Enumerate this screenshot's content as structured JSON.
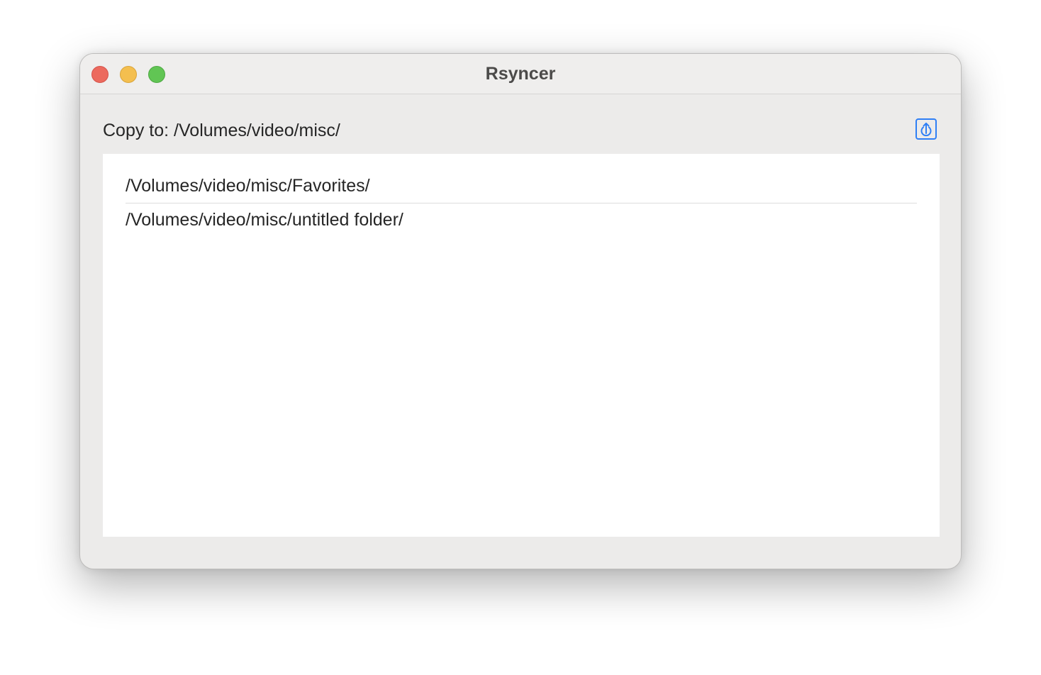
{
  "window": {
    "title": "Rsyncer"
  },
  "destination": {
    "label": "Copy to: /Volumes/video/misc/"
  },
  "toolbar": {
    "open_icon": "arrow-up-square-icon",
    "accent_color": "#2f7ff5"
  },
  "folders": [
    {
      "path": "/Volumes/video/misc/Favorites/"
    },
    {
      "path": "/Volumes/video/misc/untitled folder/"
    }
  ]
}
